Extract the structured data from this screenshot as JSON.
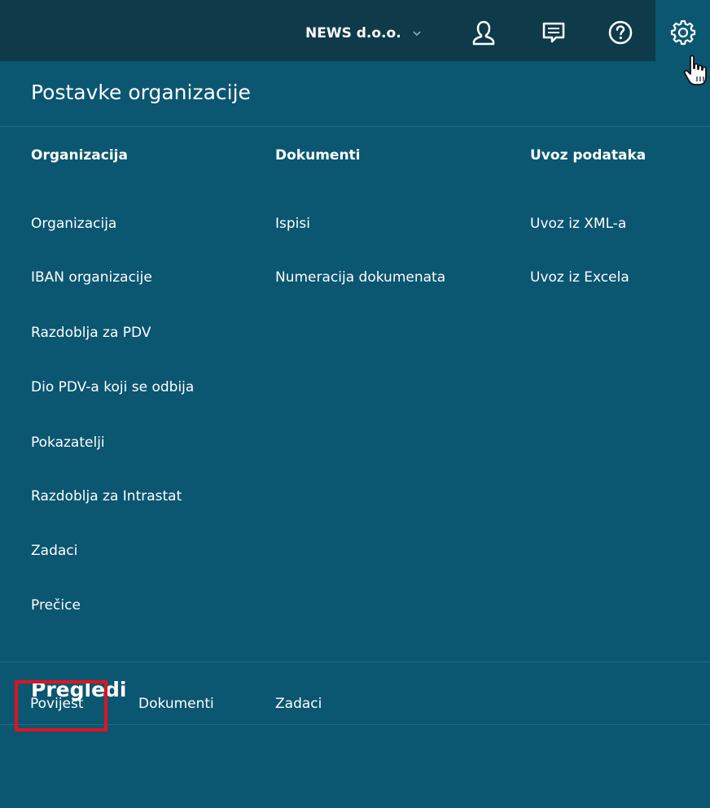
{
  "topbar": {
    "company": "NEWS d.o.o.",
    "icons": [
      "user-icon",
      "messages-icon",
      "help-icon",
      "settings-gear-icon"
    ]
  },
  "panel": {
    "title": "Postavke organizacije",
    "columns": [
      {
        "heading": "Organizacija",
        "links": [
          "Organizacija",
          "IBAN organizacije",
          "Razdoblja za PDV",
          "Dio PDV-a koji se odbija",
          "Pokazatelji",
          "Razdoblja za Intrastat",
          "Zadaci",
          "Prečice"
        ]
      },
      {
        "heading": "Dokumenti",
        "links": [
          "Ispisi",
          "Numeracija dokumenata"
        ]
      },
      {
        "heading": "Uvoz podataka",
        "links": [
          "Uvoz iz XML-a",
          "Uvoz iz Excela"
        ]
      }
    ]
  },
  "pregledi": {
    "title": "Pregledi",
    "links": [
      "Povijest",
      "Dokumenti",
      "Zadaci"
    ],
    "highlighted": "Povijest",
    "highlight_color": "#e0141e"
  },
  "colors": {
    "topbar": "#0f3a4a",
    "panel": "#0b5671",
    "text": "#ffffff"
  }
}
